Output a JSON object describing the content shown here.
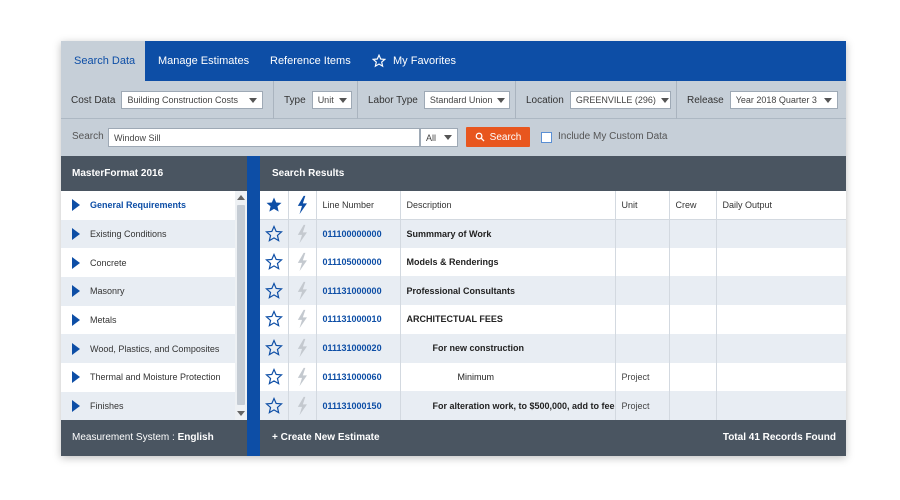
{
  "tabs": [
    {
      "label": "Search Data",
      "active": true
    },
    {
      "label": "Manage Estimates",
      "active": false
    },
    {
      "label": "Reference Items",
      "active": false
    },
    {
      "label": "My Favorites",
      "active": false
    }
  ],
  "filters": {
    "cost_data": {
      "label": "Cost Data",
      "value": "Building Construction Costs"
    },
    "type": {
      "label": "Type",
      "value": "Unit"
    },
    "labor_type": {
      "label": "Labor Type",
      "value": "Standard Union"
    },
    "location": {
      "label": "Location",
      "value": "GREENVILLE (296)"
    },
    "release": {
      "label": "Release",
      "value": "Year 2018 Quarter 3"
    }
  },
  "search": {
    "label": "Search",
    "value": "Window Sill",
    "scope": "All",
    "button_label": "Search",
    "custom_data_label": "Include My Custom Data",
    "custom_data_checked": false
  },
  "masterformat": {
    "title": "MasterFormat 2016",
    "items": [
      "General Requirements",
      "Existing Conditions",
      "Concrete",
      "Masonry",
      "Metals",
      "Wood, Plastics, and Composites",
      "Thermal and Moisture Protection",
      "Finishes"
    ],
    "selected_index": 0
  },
  "results": {
    "title": "Search Results",
    "columns": [
      "Line Number",
      "Description",
      "Unit",
      "Crew",
      "Daily Output"
    ],
    "rows": [
      {
        "line": "011100000000",
        "desc": "Summmary of Work",
        "unit": "",
        "crew": "",
        "output": "",
        "indent": 0
      },
      {
        "line": "011105000000",
        "desc": "Models & Renderings",
        "unit": "",
        "crew": "",
        "output": "",
        "indent": 0
      },
      {
        "line": "011131000000",
        "desc": "Professional Consultants",
        "unit": "",
        "crew": "",
        "output": "",
        "indent": 0
      },
      {
        "line": "011131000010",
        "desc": "ARCHITECTUAL FEES",
        "unit": "",
        "crew": "",
        "output": "",
        "indent": 0
      },
      {
        "line": "011131000020",
        "desc": "For new construction",
        "unit": "",
        "crew": "",
        "output": "",
        "indent": 1
      },
      {
        "line": "011131000060",
        "desc": "Minimum",
        "unit": "Project",
        "crew": "",
        "output": "",
        "indent": 2
      },
      {
        "line": "011131000150",
        "desc": "For alteration work, to $500,000, add to fee",
        "unit": "Project",
        "crew": "",
        "output": "",
        "indent": 1
      }
    ]
  },
  "footer": {
    "measurement_label": "Measurement System :",
    "measurement_value": "English",
    "create_label": "+ Create New Estimate",
    "total_label": "Total 41 Records Found"
  },
  "colors": {
    "primary": "#0d4ea6",
    "accent": "#e8561e",
    "header_dark": "#4a5561",
    "panel_bg": "#c6cfd8",
    "stripe": "#e8edf3"
  }
}
